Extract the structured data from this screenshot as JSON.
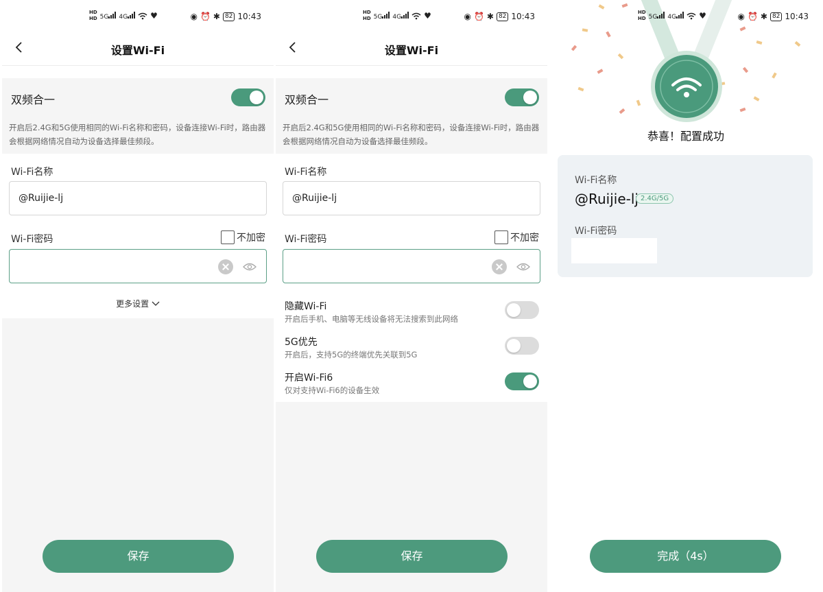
{
  "status_bar": {
    "net_5g": "5G",
    "net_4g": "4G",
    "hd": "HD",
    "battery": "82",
    "time": "10:43"
  },
  "setup": {
    "title": "设置Wi-Fi",
    "dual_band_label": "双频合一",
    "dual_band_on": true,
    "dual_band_desc": "开启后2.4G和5G使用相同的Wi-Fi名称和密码，设备连接Wi-Fi时，路由器会根据网络情况自动为设备选择最佳频段。",
    "ssid_label": "Wi-Fi名称",
    "ssid_value": "@Ruijie-lj",
    "password_label": "Wi-Fi密码",
    "password_value": "",
    "no_encrypt_label": "不加密",
    "more_settings": "更多设置",
    "save_button": "保存"
  },
  "more_options": [
    {
      "title": "隐藏Wi-Fi",
      "subtitle": "开启后手机、电脑等无线设备将无法搜索到此网络",
      "on": false
    },
    {
      "title": "5G优先",
      "subtitle": "开启后，支持5G的终端优先关联到5G",
      "on": false
    },
    {
      "title": "开启Wi-Fi6",
      "subtitle": "仅对支持Wi-Fi6的设备生效",
      "on": true
    }
  ],
  "success": {
    "message": "恭喜！配置成功",
    "ssid_label": "Wi-Fi名称",
    "ssid_value": "@Ruijie-lj",
    "band_badge": "2.4G/5G",
    "password_label": "Wi-Fi密码",
    "done_button": "完成（4s）"
  },
  "colors": {
    "accent": "#4d9a7d",
    "page_gray": "#f5f5f5",
    "card_bg": "#eef2f5"
  }
}
